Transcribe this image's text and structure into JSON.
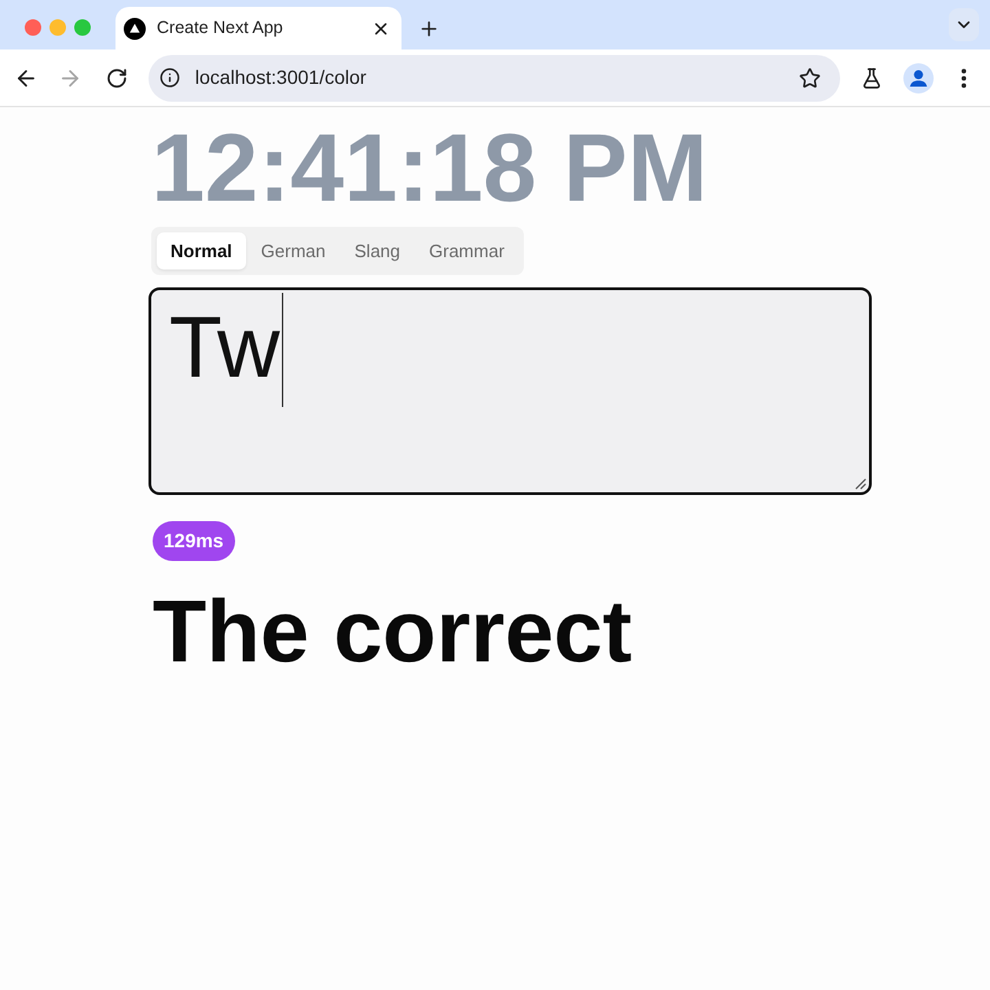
{
  "browser": {
    "tabs": [
      {
        "title": "Create Next App",
        "selected": true
      }
    ],
    "back": {
      "disabled": false
    },
    "forward": {
      "disabled": true
    },
    "address": "localhost:3001/color"
  },
  "clock": "12:41:18 PM",
  "modes": [
    {
      "label": "Normal",
      "selected": true
    },
    {
      "label": "German",
      "selected": false
    },
    {
      "label": "Slang",
      "selected": false
    },
    {
      "label": "Grammar",
      "selected": false
    }
  ],
  "input": {
    "value": "Tw",
    "focused": true
  },
  "latency_badge": "129ms",
  "result": "The correct"
}
